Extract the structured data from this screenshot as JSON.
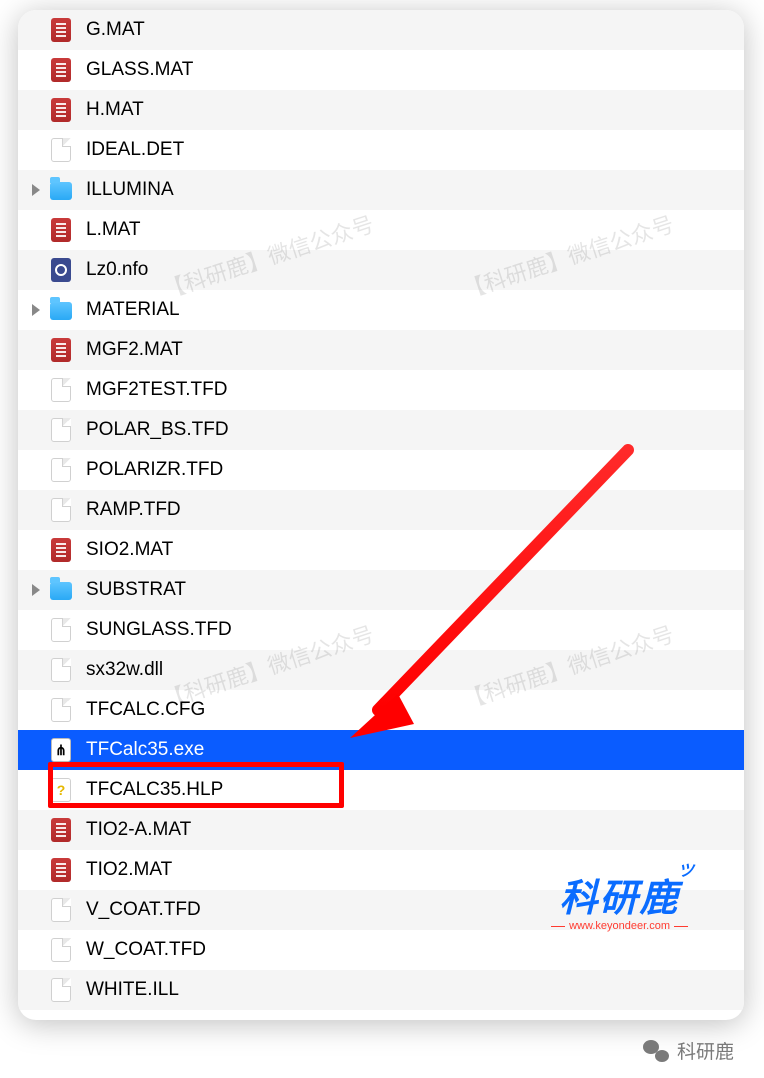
{
  "files": [
    {
      "name": "G.MAT",
      "icon": "mat",
      "folder": false,
      "selected": false
    },
    {
      "name": "GLASS.MAT",
      "icon": "mat",
      "folder": false,
      "selected": false
    },
    {
      "name": "H.MAT",
      "icon": "mat",
      "folder": false,
      "selected": false
    },
    {
      "name": "IDEAL.DET",
      "icon": "blank",
      "folder": false,
      "selected": false
    },
    {
      "name": "ILLUMINA",
      "icon": "folder",
      "folder": true,
      "selected": false
    },
    {
      "name": "L.MAT",
      "icon": "mat",
      "folder": false,
      "selected": false
    },
    {
      "name": "Lz0.nfo",
      "icon": "nfo",
      "folder": false,
      "selected": false
    },
    {
      "name": "MATERIAL",
      "icon": "folder",
      "folder": true,
      "selected": false
    },
    {
      "name": "MGF2.MAT",
      "icon": "mat",
      "folder": false,
      "selected": false
    },
    {
      "name": "MGF2TEST.TFD",
      "icon": "blank",
      "folder": false,
      "selected": false
    },
    {
      "name": "POLAR_BS.TFD",
      "icon": "blank",
      "folder": false,
      "selected": false
    },
    {
      "name": "POLARIZR.TFD",
      "icon": "blank",
      "folder": false,
      "selected": false
    },
    {
      "name": "RAMP.TFD",
      "icon": "blank",
      "folder": false,
      "selected": false
    },
    {
      "name": "SIO2.MAT",
      "icon": "mat",
      "folder": false,
      "selected": false
    },
    {
      "name": "SUBSTRAT",
      "icon": "folder",
      "folder": true,
      "selected": false
    },
    {
      "name": "SUNGLASS.TFD",
      "icon": "blank",
      "folder": false,
      "selected": false
    },
    {
      "name": "sx32w.dll",
      "icon": "blank",
      "folder": false,
      "selected": false
    },
    {
      "name": "TFCALC.CFG",
      "icon": "blank",
      "folder": false,
      "selected": false
    },
    {
      "name": "TFCalc35.exe",
      "icon": "exe",
      "folder": false,
      "selected": true
    },
    {
      "name": "TFCALC35.HLP",
      "icon": "hlp",
      "folder": false,
      "selected": false
    },
    {
      "name": "TIO2-A.MAT",
      "icon": "mat",
      "folder": false,
      "selected": false
    },
    {
      "name": "TIO2.MAT",
      "icon": "mat",
      "folder": false,
      "selected": false
    },
    {
      "name": "V_COAT.TFD",
      "icon": "blank",
      "folder": false,
      "selected": false
    },
    {
      "name": "W_COAT.TFD",
      "icon": "blank",
      "folder": false,
      "selected": false
    },
    {
      "name": "WHITE.ILL",
      "icon": "blank",
      "folder": false,
      "selected": false
    }
  ],
  "watermark_text": "【科研鹿】微信公众号",
  "brand": {
    "name": "科研鹿",
    "url": "www.keyondeer.com"
  },
  "footer": {
    "label": "科研鹿"
  },
  "colors": {
    "selection": "#0a5cff",
    "highlight": "#ff0000",
    "brand": "#0a6cff"
  }
}
